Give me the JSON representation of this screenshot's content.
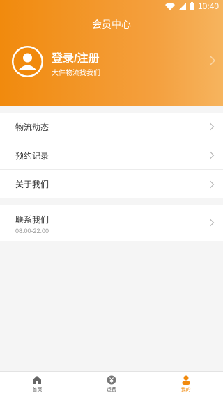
{
  "status": {
    "time": "10:40"
  },
  "header": {
    "title": "会员中心",
    "login_title": "登录/注册",
    "login_subtitle": "大件物流找我们"
  },
  "menu": [
    {
      "label": "物流动态"
    },
    {
      "label": "预约记录"
    },
    {
      "label": "关于我们"
    }
  ],
  "contact": {
    "label": "联系我们",
    "hours": "08:00-22:00"
  },
  "tabbar": [
    {
      "label": "首页",
      "icon": "home-icon",
      "active": false
    },
    {
      "label": "运费",
      "icon": "yen-icon",
      "active": false
    },
    {
      "label": "我的",
      "icon": "person-icon",
      "active": true
    }
  ],
  "colors": {
    "accent": "#f18a0d",
    "header_end": "#f6b45e",
    "background": "#f5f5f5"
  }
}
